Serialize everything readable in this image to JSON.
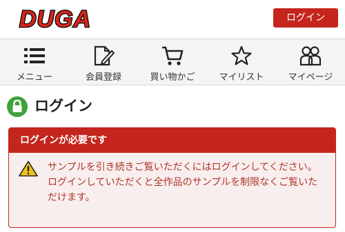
{
  "header": {
    "logo_text": "DUGA",
    "login_button": "ログイン",
    "brand_color": "#c4261d"
  },
  "nav": {
    "items": [
      {
        "label": "メニュー",
        "icon": "menu-icon"
      },
      {
        "label": "会員登録",
        "icon": "register-icon"
      },
      {
        "label": "買い物かご",
        "icon": "cart-icon"
      },
      {
        "label": "マイリスト",
        "icon": "star-icon"
      },
      {
        "label": "マイページ",
        "icon": "mypage-icon"
      }
    ]
  },
  "page": {
    "title": "ログイン",
    "title_icon": "lock-icon"
  },
  "alert": {
    "heading": "ログインが必要です",
    "icon": "warning-icon",
    "message_1": "サンプルを引き続きご覧いただくにはログインしてください。",
    "message_2": "ログインしていただくと全作品のサンプルを制限なくご覧いただけます。",
    "text_color": "#b0352a"
  }
}
